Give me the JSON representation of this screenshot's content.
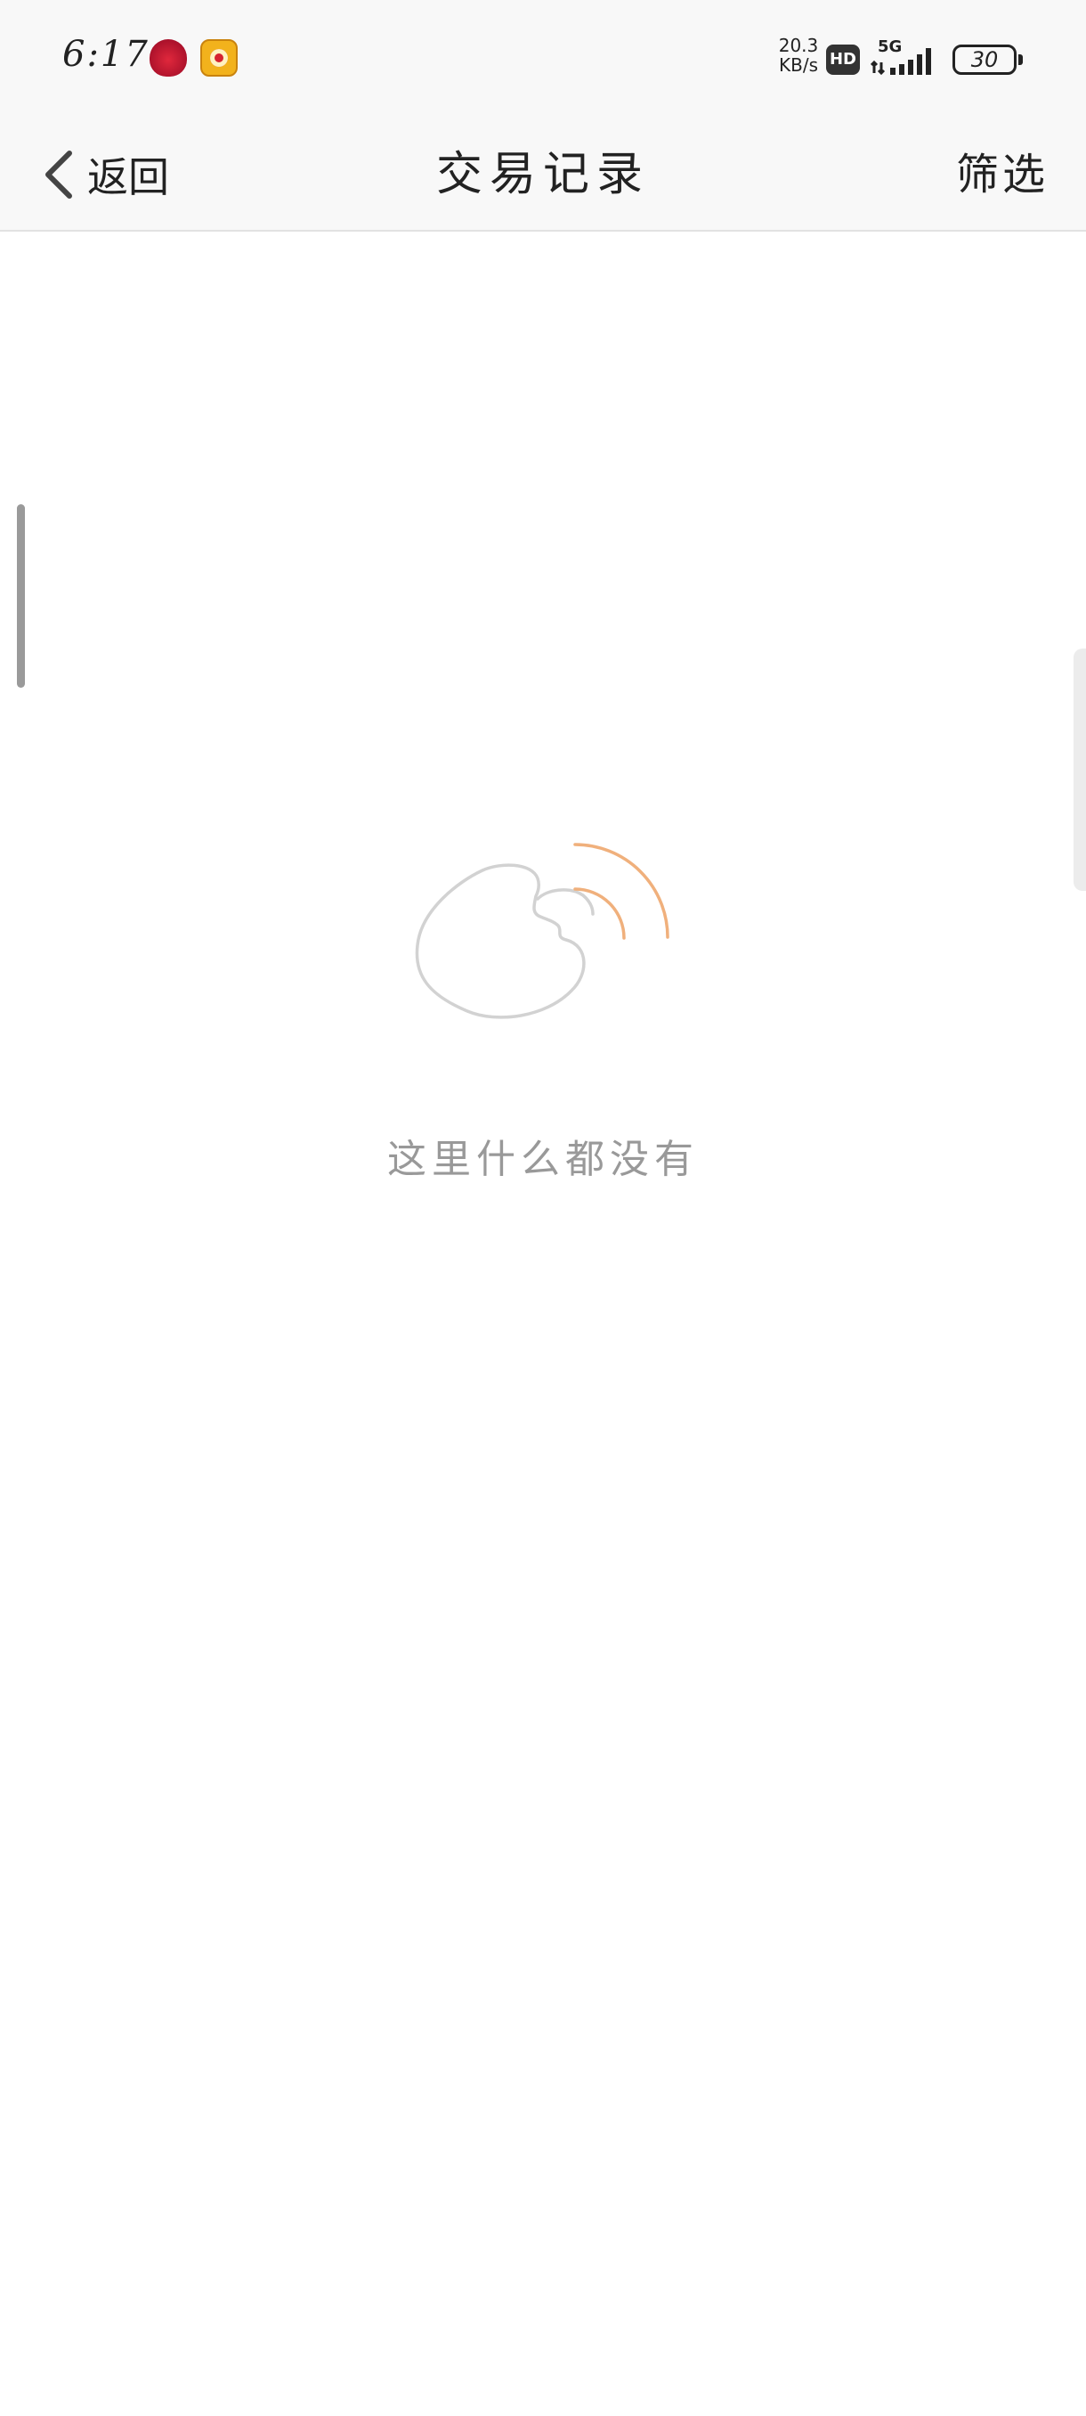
{
  "status_bar": {
    "time": "6:17",
    "net_speed_value": "20.3",
    "net_speed_unit": "KB/s",
    "hd_label": "HD",
    "network_type": "5G",
    "battery_level": "30"
  },
  "nav": {
    "back_label": "返回",
    "title": "交易记录",
    "filter_label": "筛选"
  },
  "empty_state": {
    "message": "这里什么都没有"
  },
  "colors": {
    "signal_arc": "#f0b07c",
    "outline": "#d2d2d2",
    "empty_text": "#999999"
  }
}
